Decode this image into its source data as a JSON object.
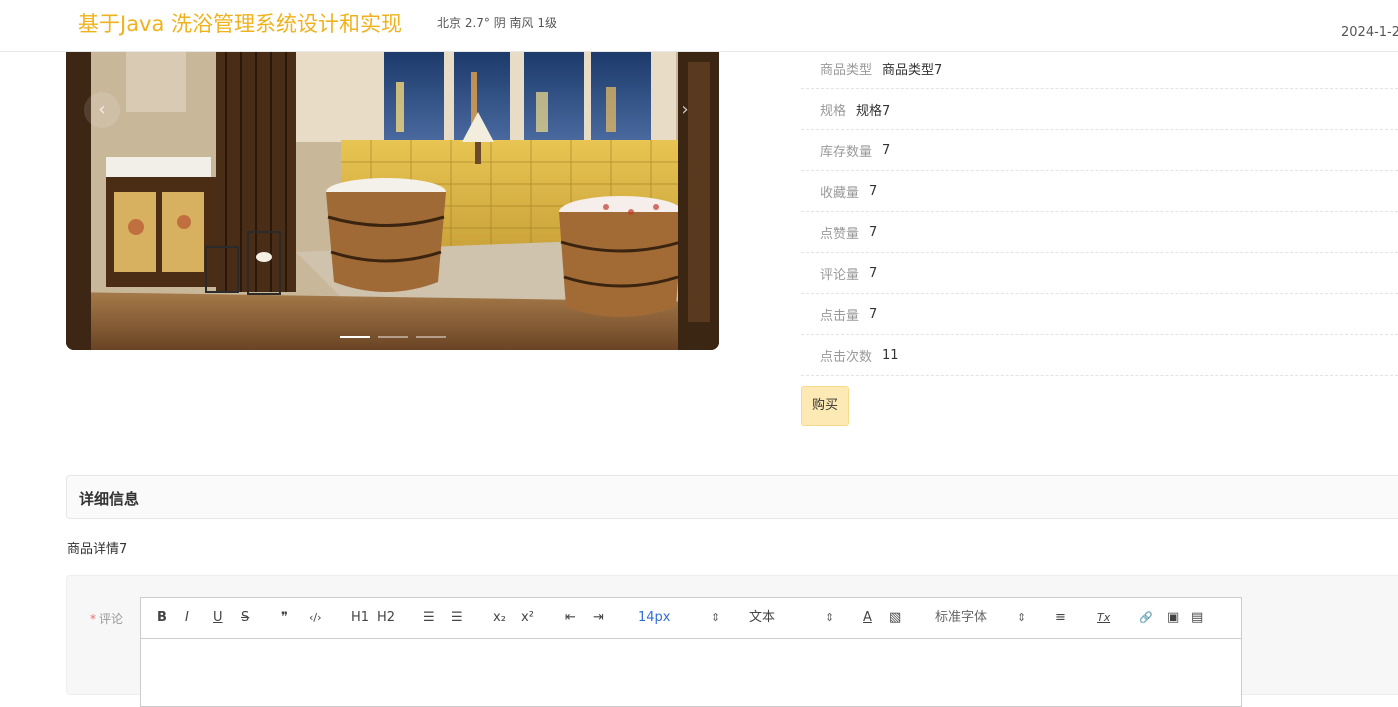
{
  "header": {
    "title": "基于Java 洗浴管理系统设计和实现",
    "weather": "北京 2.7° 阴 南风 1级",
    "date": "2024-1-2"
  },
  "carousel": {
    "prev": "‹",
    "next": "›",
    "slide_count": 3,
    "active_index": 0
  },
  "details": [
    {
      "label": "商品类型",
      "value": "商品类型7"
    },
    {
      "label": "规格",
      "value": "规格7"
    },
    {
      "label": "库存数量",
      "value": "7"
    },
    {
      "label": "收藏量",
      "value": "7"
    },
    {
      "label": "点赞量",
      "value": "7"
    },
    {
      "label": "评论量",
      "value": "7"
    },
    {
      "label": "点击量",
      "value": "7"
    },
    {
      "label": "点击次数",
      "value": "11"
    }
  ],
  "buy_label": "购买",
  "detail_section": {
    "title": "详细信息",
    "content": "商品详情7"
  },
  "comment": {
    "required_mark": "*",
    "label": "评论"
  },
  "toolbar": {
    "bold": "B",
    "italic": "I",
    "underline": "U",
    "strike": "S",
    "quote": "❞",
    "code": "‹/›",
    "h1": "H1",
    "h2": "H2",
    "ordered_list": "☰",
    "bullet_list": "☰",
    "sub": "x₂",
    "sup": "x²",
    "outdent": "⇤",
    "indent": "⇥",
    "font_size": "14px",
    "header_select": "文本",
    "color": "A",
    "background": "▧",
    "font_family": "标准字体",
    "align": "≡",
    "clean": "Tx",
    "link": "🔗",
    "image": "▣",
    "video": "▤",
    "select_arrow": "⇕"
  }
}
